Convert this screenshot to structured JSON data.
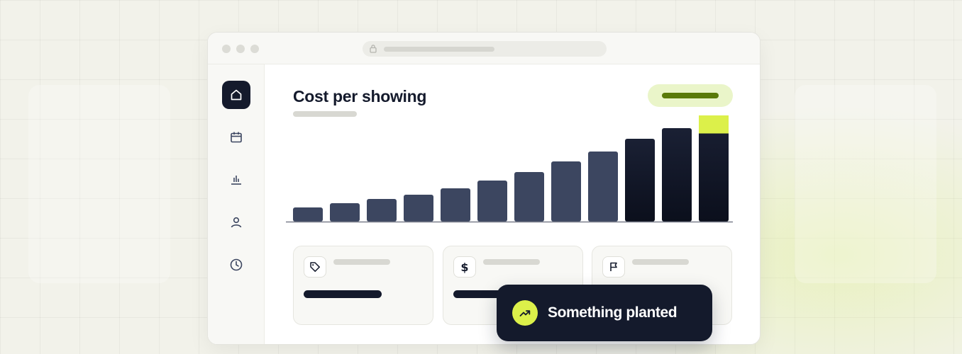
{
  "colors": {
    "background": "#f2f2ea",
    "dark_navy": "#141a2c",
    "slate_bar": "#3c4660",
    "accent_lime": "#dcf04a",
    "pill_bg": "#eaf5c9",
    "pill_line": "#5a7a0a"
  },
  "window": {
    "title_dots": [
      "dot",
      "dot",
      "dot"
    ],
    "address_icon": "lock-icon"
  },
  "sidebar": {
    "items": [
      {
        "icon": "home-icon",
        "active": true
      },
      {
        "icon": "calendar-icon",
        "active": false
      },
      {
        "icon": "bar-chart-icon",
        "active": false
      },
      {
        "icon": "user-icon",
        "active": false
      },
      {
        "icon": "clock-icon",
        "active": false
      }
    ]
  },
  "main": {
    "title": "Cost per showing"
  },
  "chart_data": {
    "type": "bar",
    "title": "Cost per showing",
    "values": [
      20,
      26,
      32,
      38,
      47,
      58,
      70,
      85,
      99,
      117,
      132,
      150
    ],
    "highlight_last_top_fraction": 0.17,
    "dark_from_index": 9,
    "ylim": [
      0,
      150
    ],
    "grid": false
  },
  "cards": [
    {
      "icon": "tag-icon"
    },
    {
      "icon": "dollar-icon",
      "icon_glyph": "$"
    },
    {
      "icon": "flag-icon"
    }
  ],
  "toast": {
    "icon": "trending-up-icon",
    "text": "Something planted"
  }
}
